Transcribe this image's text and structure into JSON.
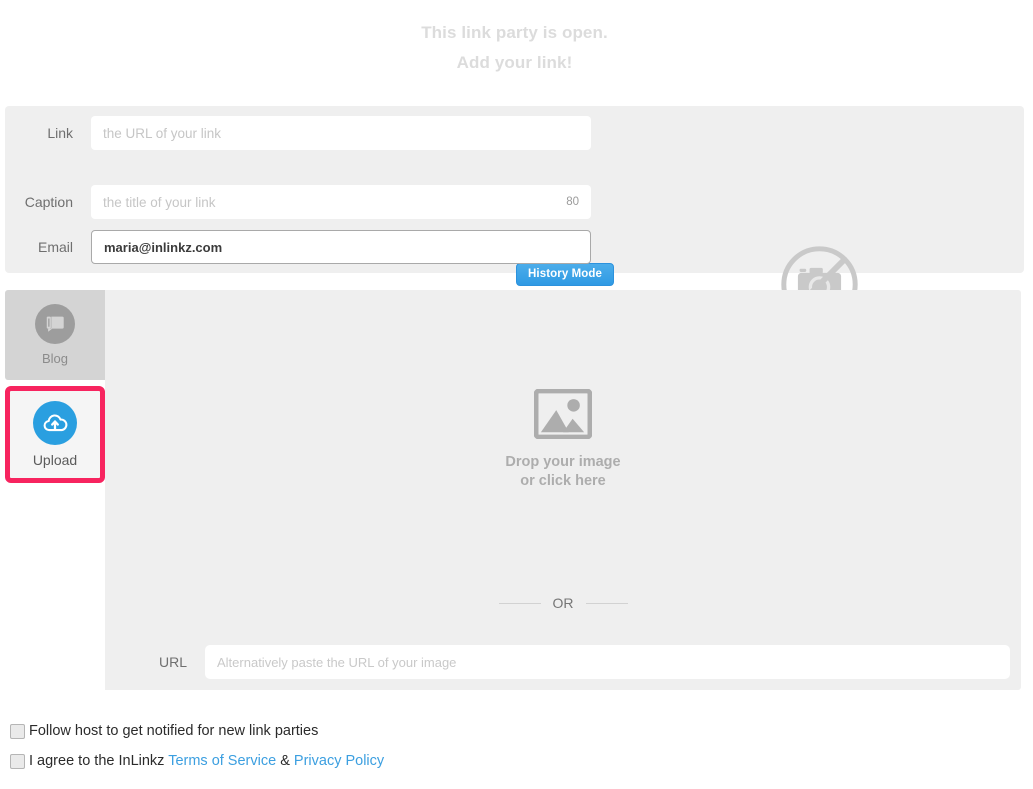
{
  "header": {
    "line1": "This link party is open.",
    "line2": "Add your link!"
  },
  "form": {
    "link": {
      "label": "Link",
      "placeholder": "the URL of your link",
      "value": ""
    },
    "caption": {
      "label": "Caption",
      "placeholder": "the title of your link",
      "value": "",
      "counter": "80"
    },
    "email": {
      "label": "Email",
      "placeholder": "",
      "value": "maria@inlinkz.com"
    },
    "history_mode_button": "History Mode",
    "no_camera_icon": "no-camera-icon"
  },
  "tabs": [
    {
      "label": "Blog",
      "icon": "blog-icon",
      "selected": false
    },
    {
      "label": "Upload",
      "icon": "cloud-upload-icon",
      "selected": true
    }
  ],
  "dropzone": {
    "icon": "image-placeholder-icon",
    "line1": "Drop your image",
    "line2": "or click here"
  },
  "or_divider": "OR",
  "url_field": {
    "label": "URL",
    "placeholder": "Alternatively paste the URL of your image",
    "value": ""
  },
  "checkboxes": [
    {
      "text": "Follow host to get notified for new link parties",
      "checked": false
    },
    {
      "text_before": "I agree to the InLinkz ",
      "link1": "Terms of Service",
      "between": " & ",
      "link2": "Privacy Policy",
      "checked": false
    }
  ],
  "colors": {
    "accent_blue": "#2a9fe0",
    "highlight_pink": "#f7245f",
    "panel_gray": "#efefef",
    "tab_gray": "#d4d4d4",
    "link_blue": "#3c9fe0"
  }
}
